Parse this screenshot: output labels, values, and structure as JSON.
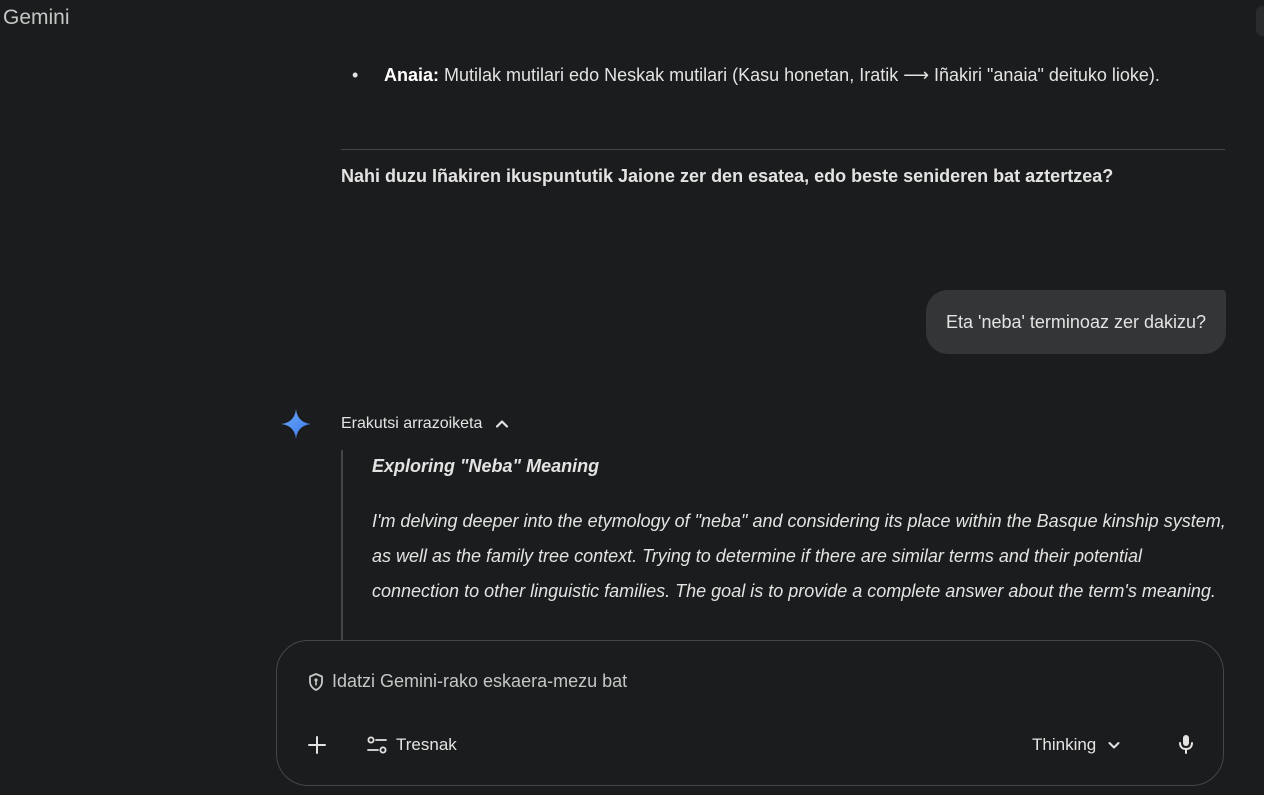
{
  "app": {
    "title": "Gemini"
  },
  "conversation": {
    "bullet": {
      "term": "Anaia:",
      "text": " Mutilak mutilari edo Neskak mutilari (Kasu honetan, Iratik ⟶ Iñakiri \"anaia\" deituko lioke)."
    },
    "follow_up_question": "Nahi duzu Iñakiren ikuspuntutik Jaione zer den esatea, edo beste senideren bat aztertzea?",
    "user_message": "Eta 'neba' terminoaz zer dakizu?",
    "thoughts": {
      "toggle_label": "Erakutsi arrazoiketa",
      "title": "Exploring \"Neba\" Meaning",
      "body": "I'm delving deeper into the etymology of \"neba\" and considering its place within the Basque kinship system, as well as the family tree context. Trying to determine if there are similar terms and their potential connection to other linguistic families. The goal is to provide a complete answer about the term's meaning."
    }
  },
  "composer": {
    "placeholder": "Idatzi Gemini-rako eskaera-mezu bat",
    "tools_label": "Tresnak",
    "mode_label": "Thinking"
  },
  "icons": {
    "spark": "gemini-spark-icon",
    "chevron_up": "chevron-up-icon",
    "shield": "shield-icon",
    "plus": "plus-icon",
    "tools": "tools-sliders-icon",
    "chevron_down": "chevron-down-icon",
    "mic": "microphone-icon"
  },
  "colors": {
    "background": "#1b1c1d",
    "bubble": "#333537",
    "text": "#e3e3e3",
    "muted": "#c4c7c5",
    "border": "#444746",
    "spark_blue": "#4e8df5"
  }
}
